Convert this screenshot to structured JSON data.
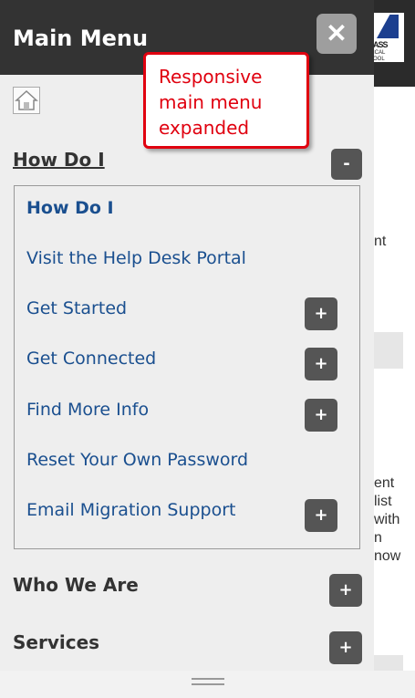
{
  "menu": {
    "title": "Main Menu",
    "close_label": "✕",
    "home_icon": "home-icon"
  },
  "sections": {
    "how_do_i": {
      "label": "How Do I",
      "toggle": "-",
      "items": [
        {
          "label": "How Do I"
        },
        {
          "label": "Visit the Help Desk Portal"
        },
        {
          "label": "Get Started",
          "toggle": "+"
        },
        {
          "label": "Get Connected",
          "toggle": "+"
        },
        {
          "label": "Find More Info",
          "toggle": "+"
        },
        {
          "label": "Reset Your Own Password"
        },
        {
          "label": "Email Migration Support",
          "toggle": "+"
        }
      ]
    },
    "who_we_are": {
      "label": "Who We Are",
      "toggle": "+"
    },
    "services": {
      "label": "Services",
      "toggle": "+"
    }
  },
  "background": {
    "logo_text": "ASS",
    "logo_line2": "ICAL",
    "logo_line3": "OOL",
    "fragments": [
      "nt",
      "ent",
      "list",
      "with",
      "n",
      "now"
    ]
  },
  "callout": {
    "line1": "Responsive",
    "line2": "main menu",
    "line3": "expanded"
  },
  "colors": {
    "accent_red": "#e0000f",
    "link_blue": "#1a4f8f",
    "header_dark": "#333333"
  }
}
